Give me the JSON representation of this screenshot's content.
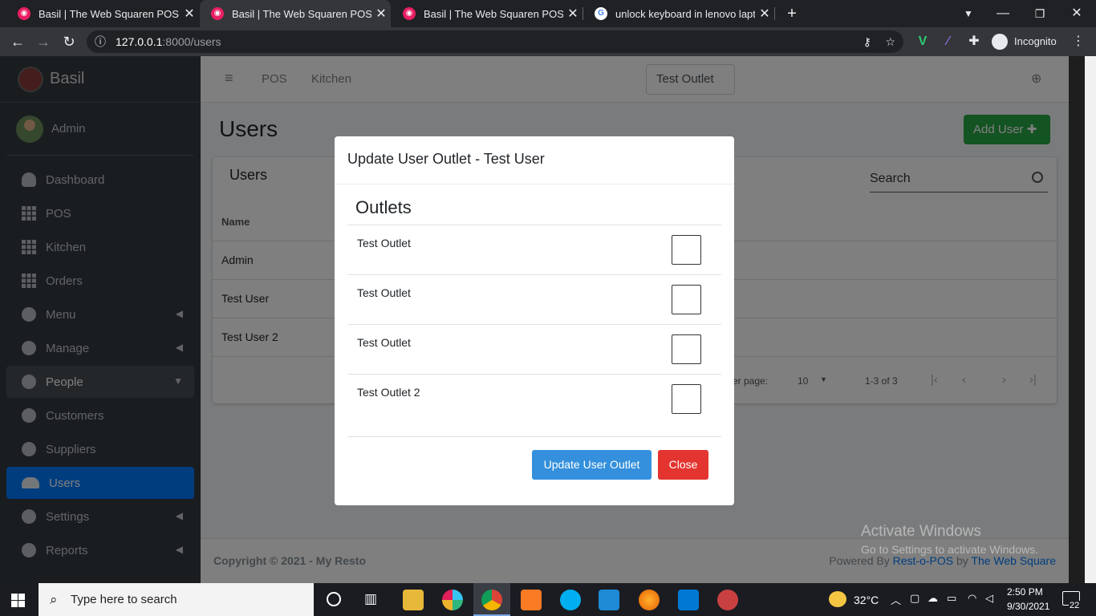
{
  "browser": {
    "tabs": [
      {
        "title": "Basil | The Web Squaren POS",
        "active": false
      },
      {
        "title": "Basil | The Web Squaren POS",
        "active": true
      },
      {
        "title": "Basil | The Web Squaren POS",
        "active": false
      },
      {
        "title": "unlock keyboard in lenovo laptop",
        "active": false
      }
    ],
    "url_host": "127.0.0.1",
    "url_path": ":8000/users",
    "profile_label": "Incognito"
  },
  "sidebar": {
    "brand": "Basil",
    "user": "Admin",
    "items": [
      {
        "label": "Dashboard",
        "icon": "dashboard-icon"
      },
      {
        "label": "POS",
        "icon": "grid-icon"
      },
      {
        "label": "Kitchen",
        "icon": "grid-icon"
      },
      {
        "label": "Orders",
        "icon": "grid-icon"
      },
      {
        "label": "Menu",
        "icon": "circle-icon",
        "chevron": "left"
      },
      {
        "label": "Manage",
        "icon": "circle-icon",
        "chevron": "left"
      },
      {
        "label": "People",
        "icon": "circle-icon",
        "chevron": "down"
      },
      {
        "label": "Customers",
        "icon": "circle-icon"
      },
      {
        "label": "Suppliers",
        "icon": "circle-icon"
      },
      {
        "label": "Users",
        "icon": "users-icon"
      },
      {
        "label": "Settings",
        "icon": "circle-icon",
        "chevron": "left"
      },
      {
        "label": "Reports",
        "icon": "circle-icon",
        "chevron": "left"
      }
    ]
  },
  "topnav": {
    "links": [
      "POS",
      "Kitchen"
    ],
    "outlet_select": "Test Outlet"
  },
  "page": {
    "title": "Users",
    "add_button": "Add User",
    "card_title": "Users",
    "search_label": "Search",
    "column_name": "Name",
    "rows": [
      "Admin",
      "Test User",
      "Test User 2"
    ],
    "per_page_label": "er page:",
    "per_page_value": "10",
    "range": "1-3 of 3"
  },
  "footer": {
    "copyright": "Copyright © 2021 - My Resto",
    "powered_prefix": "Powered By ",
    "powered_product": "Rest-o-POS",
    "powered_by": " by ",
    "powered_company": "The Web Square"
  },
  "watermark": {
    "line1": "Activate Windows",
    "line2": "Go to Settings to activate Windows."
  },
  "modal": {
    "title": "Update User Outlet - Test User",
    "section": "Outlets",
    "outlets": [
      {
        "name": "Test Outlet",
        "checked": false
      },
      {
        "name": "Test Outlet",
        "checked": false
      },
      {
        "name": "Test Outlet",
        "checked": false
      },
      {
        "name": "Test Outlet 2",
        "checked": false
      }
    ],
    "update_button": "Update User Outlet",
    "close_button": "Close"
  },
  "taskbar": {
    "search_placeholder": "Type here to search",
    "temperature": "32°C",
    "time": "2:50 PM",
    "date": "9/30/2021",
    "notifications": "22"
  },
  "colors": {
    "sidebar_bg": "#343a40",
    "active_nav": "#007bff",
    "add_user": "#28a745",
    "update_btn": "#3490dc",
    "close_btn": "#e3342f"
  }
}
